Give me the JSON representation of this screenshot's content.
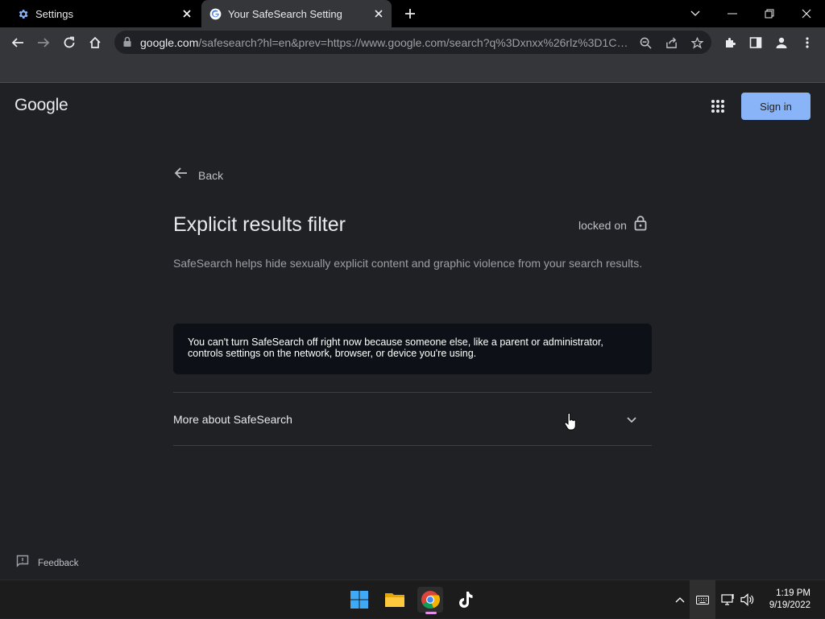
{
  "browser": {
    "tabs": [
      {
        "title": "Settings",
        "active": false,
        "favicon": "gear-icon"
      },
      {
        "title": "Your SafeSearch Setting",
        "active": true,
        "favicon": "google-g-icon"
      }
    ],
    "url_host": "google.com",
    "url_rest": "/safesearch?hl=en&prev=https://www.google.com/search?q%3Dxnxx%26rlz%3D1C1..."
  },
  "page": {
    "logo": "Google",
    "sign_in": "Sign in",
    "back": "Back",
    "title": "Explicit results filter",
    "locked_status": "locked on",
    "description": "SafeSearch helps hide sexually explicit content and graphic violence from your search results.",
    "notice": "You can't turn SafeSearch off right now because someone else, like a parent or administrator, controls settings on the network, browser, or device you're using.",
    "more_about": "More about SafeSearch",
    "feedback": "Feedback"
  },
  "taskbar": {
    "apps": [
      "windows-start-icon",
      "file-explorer-icon",
      "chrome-icon",
      "tiktok-icon"
    ],
    "time": "1:19 PM",
    "date": "9/19/2022"
  },
  "colors": {
    "accent": "#8ab4f8",
    "page_bg": "#202124",
    "notice_bg": "#0d1117"
  }
}
